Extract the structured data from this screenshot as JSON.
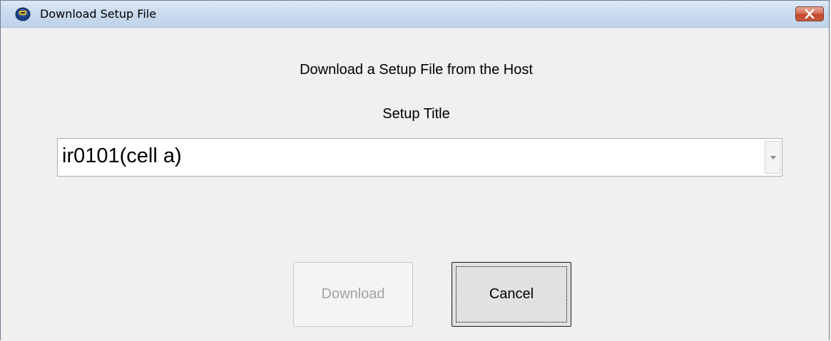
{
  "window": {
    "title": "Download Setup File",
    "close_icon": "close-icon"
  },
  "dialog": {
    "heading": "Download a Setup File from the Host",
    "setup_title_label": "Setup Title",
    "setup_title_value": "ir0101(cell a)"
  },
  "buttons": {
    "download_label": "Download",
    "download_enabled": false,
    "cancel_label": "Cancel"
  },
  "colors": {
    "close_button": "#c2462a",
    "disabled_text": "#a3a3a3"
  }
}
